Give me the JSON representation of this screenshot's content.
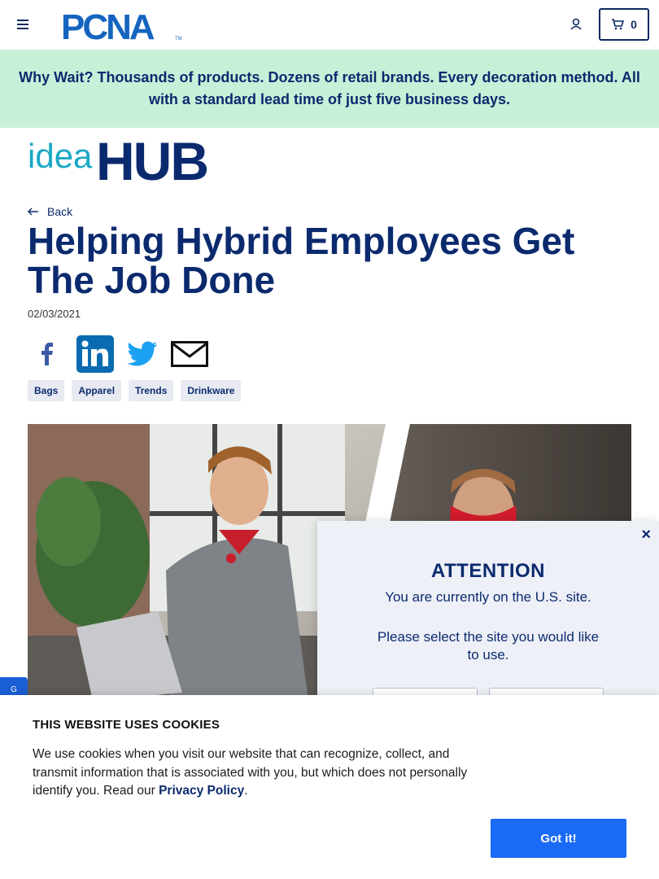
{
  "header": {
    "logo_text": "PCNA",
    "trademark": "TM",
    "cart_count": "0"
  },
  "promo": {
    "text": "Why Wait? Thousands of products. Dozens of retail brands. Every decoration method. All with a standard lead time of just five business days."
  },
  "idea_hub": {
    "idea": "idea",
    "hub": "HUB"
  },
  "article": {
    "back_label": "Back",
    "title": "Helping Hybrid Employees Get The Job Done",
    "date": "02/03/2021",
    "tags": [
      "Bags",
      "Apparel",
      "Trends",
      "Drinkware"
    ]
  },
  "feedback_tab": {
    "label": "G"
  },
  "attention_modal": {
    "close_label": "×",
    "heading": "ATTENTION",
    "message1": "You are currently on the U.S. site.",
    "message2": "Please select the site you would like to use."
  },
  "cookie_banner": {
    "heading": "THIS WEBSITE USES COOKIES",
    "text_before": "We use cookies when you visit our website that can recognize, collect, and transmit information that is associated with you, but which does not personally identify you. Read our ",
    "link_label": "Privacy Policy",
    "text_after": ".",
    "button_label": "Got it!"
  },
  "colors": {
    "brand_navy": "#0b2a6e",
    "promo_bg": "#c8f0d8",
    "idea_teal": "#1aa8c4",
    "button_blue": "#1a6af5"
  },
  "icons": [
    "menu-icon",
    "account-icon",
    "cart-icon",
    "arrow-left-icon",
    "facebook-icon",
    "linkedin-icon",
    "twitter-icon",
    "email-icon",
    "close-icon"
  ]
}
